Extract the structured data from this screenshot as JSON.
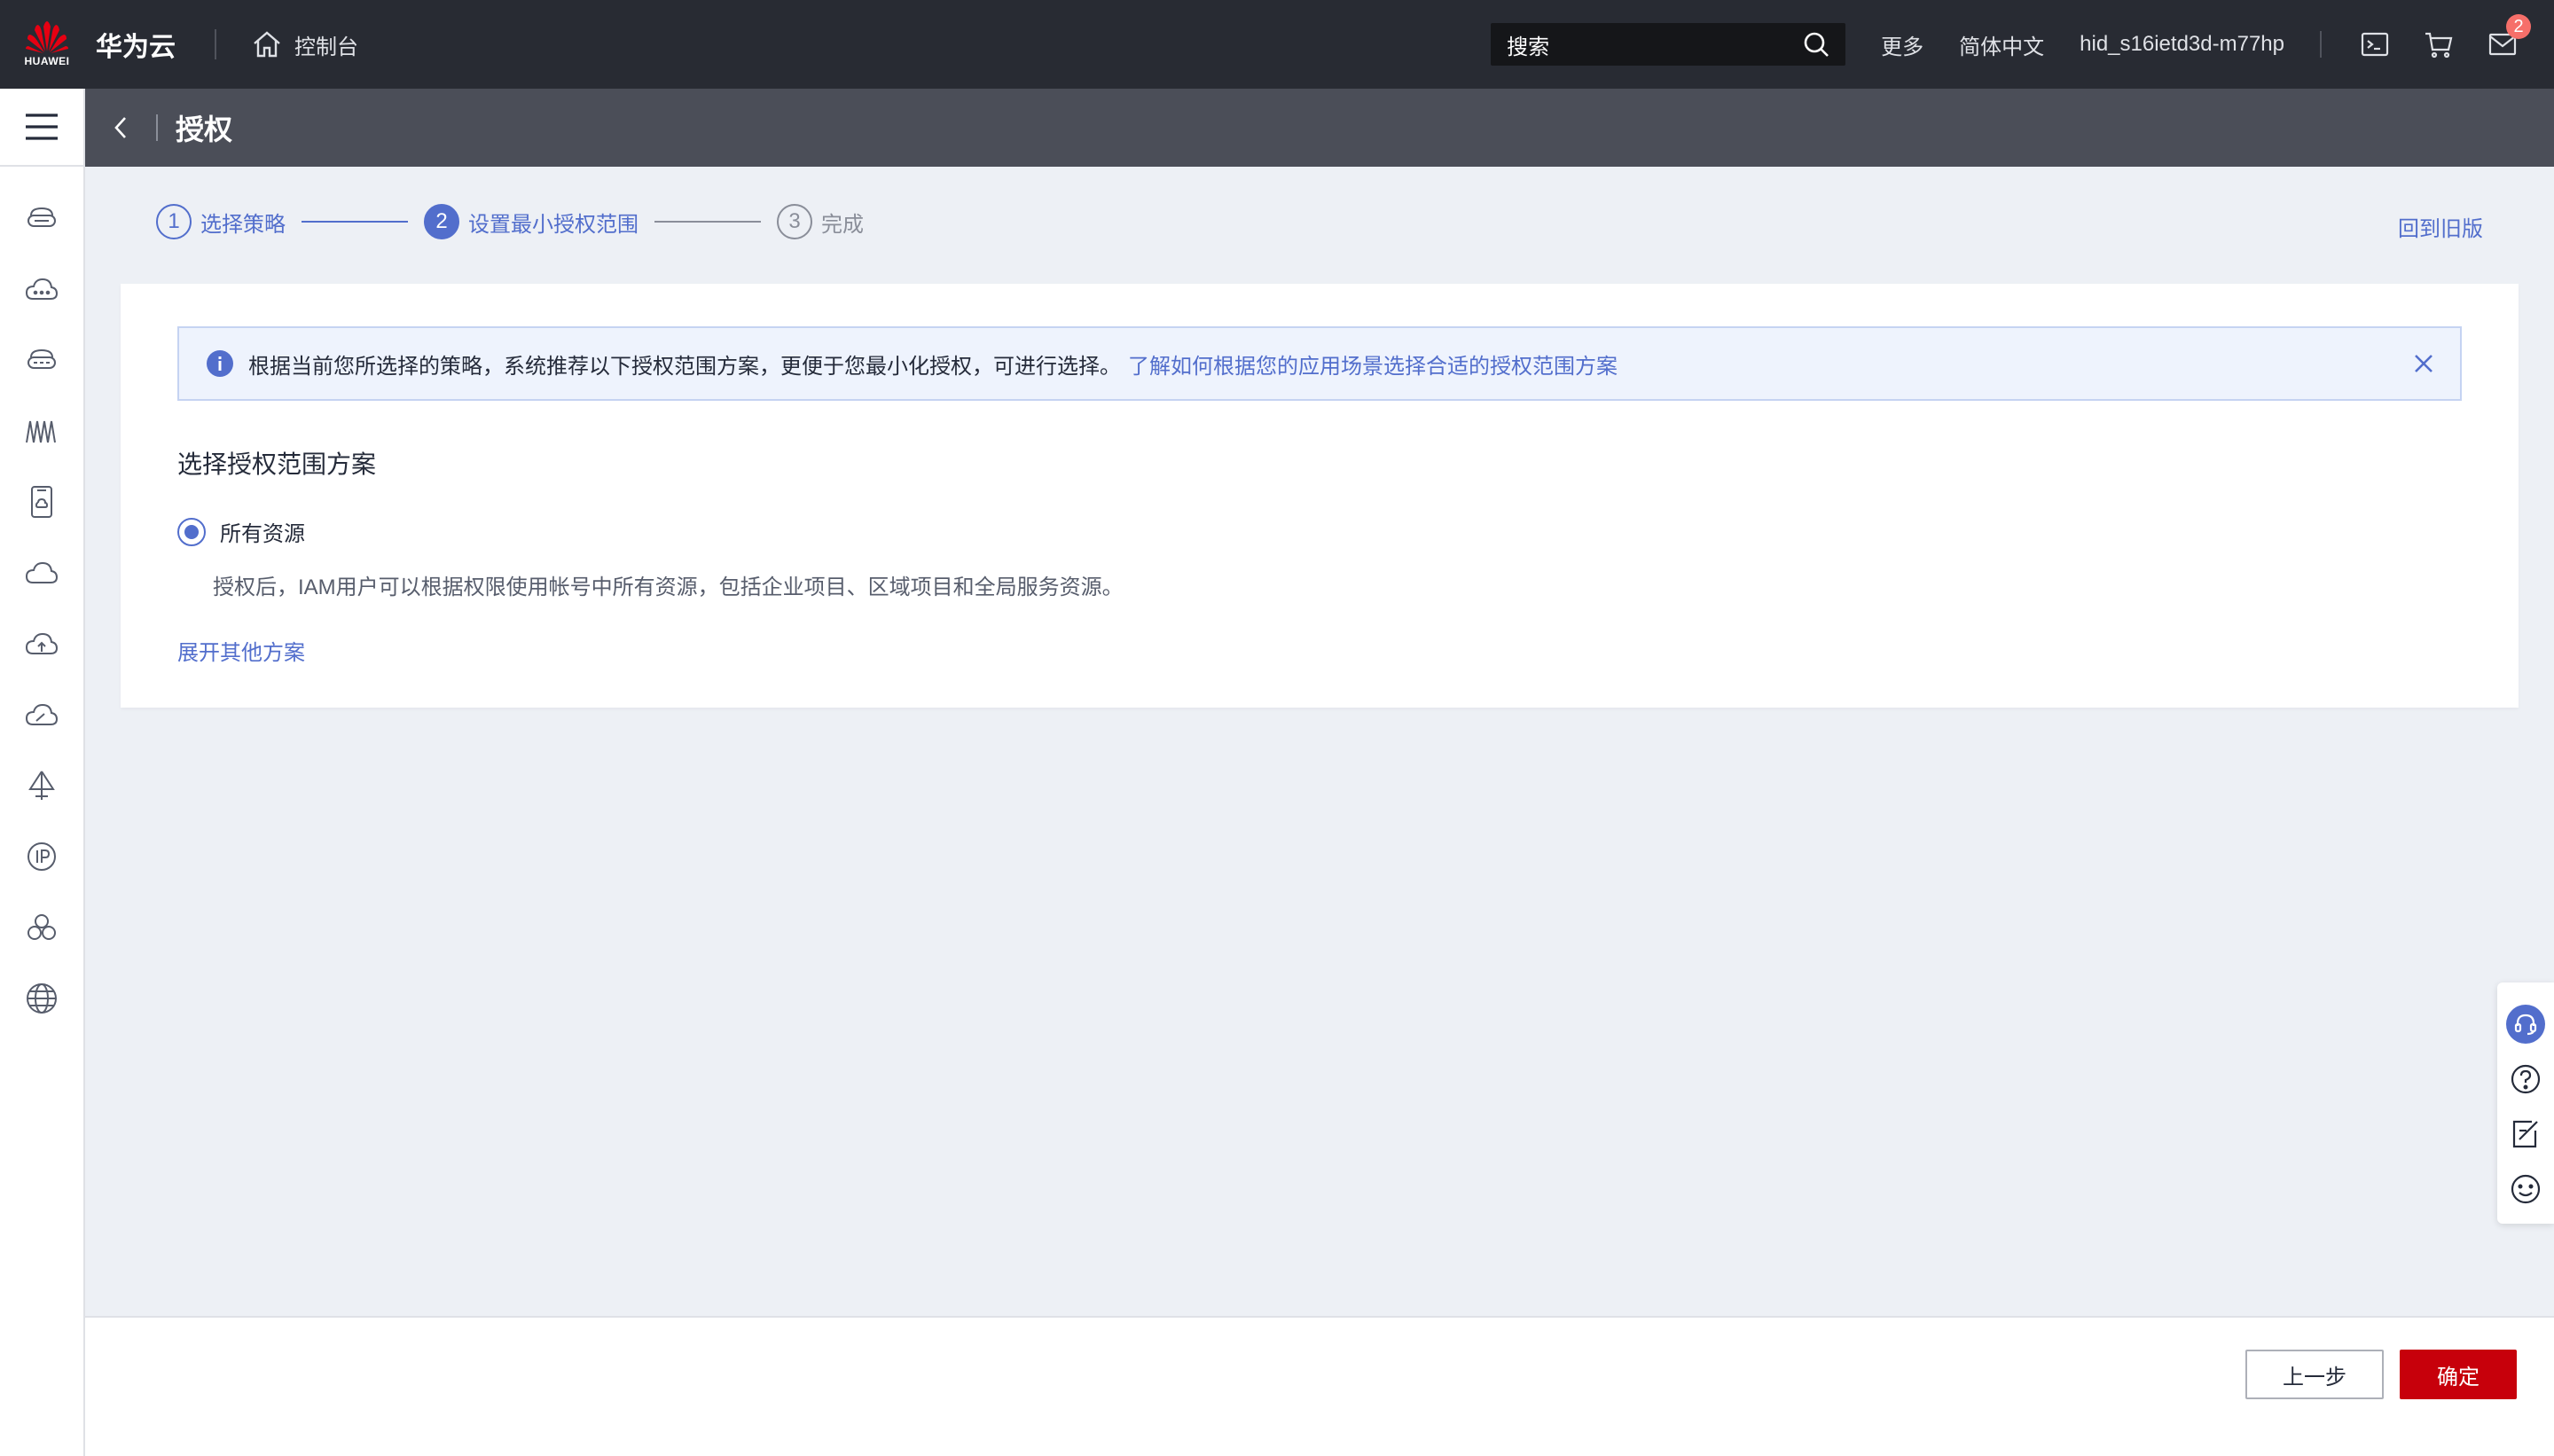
{
  "topbar": {
    "logo_text": "HUAWEI",
    "brand": "华为云",
    "console_label": "控制台",
    "search_placeholder": "搜索",
    "more_label": "更多",
    "language_label": "简体中文",
    "username": "hid_s16ietd3d-m77hp",
    "message_count": "2",
    "icons": [
      "terminal-icon",
      "cart-icon",
      "mail-icon"
    ]
  },
  "page": {
    "title": "授权",
    "old_version_link": "回到旧版"
  },
  "steps": [
    {
      "number": "1",
      "label": "选择策略",
      "state": "done"
    },
    {
      "number": "2",
      "label": "设置最小授权范围",
      "state": "active"
    },
    {
      "number": "3",
      "label": "完成",
      "state": "pending"
    }
  ],
  "alert": {
    "text": "根据当前您所选择的策略，系统推荐以下授权范围方案，更便于您最小化授权，可进行选择。",
    "link": "了解如何根据您的应用场景选择合适的授权范围方案"
  },
  "scope": {
    "section_title": "选择授权范围方案",
    "option_label": "所有资源",
    "option_desc": "授权后，IAM用户可以根据权限使用帐号中所有资源，包括企业项目、区域项目和全局服务资源。",
    "expand_link": "展开其他方案"
  },
  "footer": {
    "prev_label": "上一步",
    "confirm_label": "确定"
  },
  "colors": {
    "topbar_bg": "#282b33",
    "accent": "#526ecc",
    "confirm_red": "#c7000b",
    "page_bg": "#edf0f5"
  }
}
